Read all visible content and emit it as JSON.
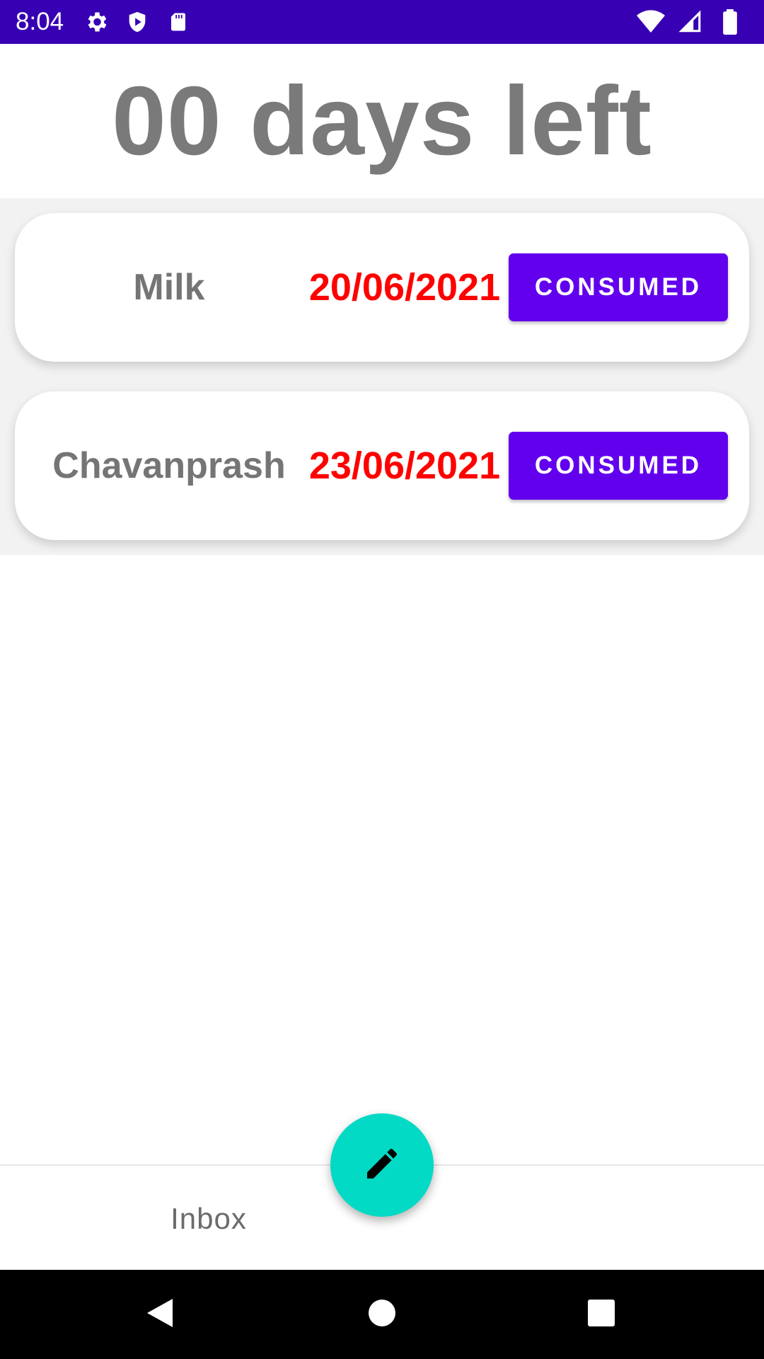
{
  "status_bar": {
    "time": "8:04",
    "left_icons": [
      "gear-icon",
      "shield-play-icon",
      "sd-card-icon"
    ],
    "right_icons": [
      "wifi-icon",
      "signal-icon",
      "battery-icon"
    ],
    "color": "#3700b3"
  },
  "header": {
    "days_left": "00 days left"
  },
  "items": [
    {
      "name": "Milk",
      "date": "20/06/2021",
      "action_label": "CONSUMED"
    },
    {
      "name": "Chavanprash",
      "date": "23/06/2021",
      "action_label": "CONSUMED"
    }
  ],
  "bottom_bar": {
    "inbox_label": "Inbox",
    "fab_icon": "pencil-icon"
  },
  "nav_bar": {
    "icons": [
      "back-icon",
      "home-icon",
      "recents-icon"
    ]
  },
  "colors": {
    "accent": "#6200ee",
    "fab": "#03dac5",
    "date": "#ff0000",
    "text_gray": "#757575"
  }
}
